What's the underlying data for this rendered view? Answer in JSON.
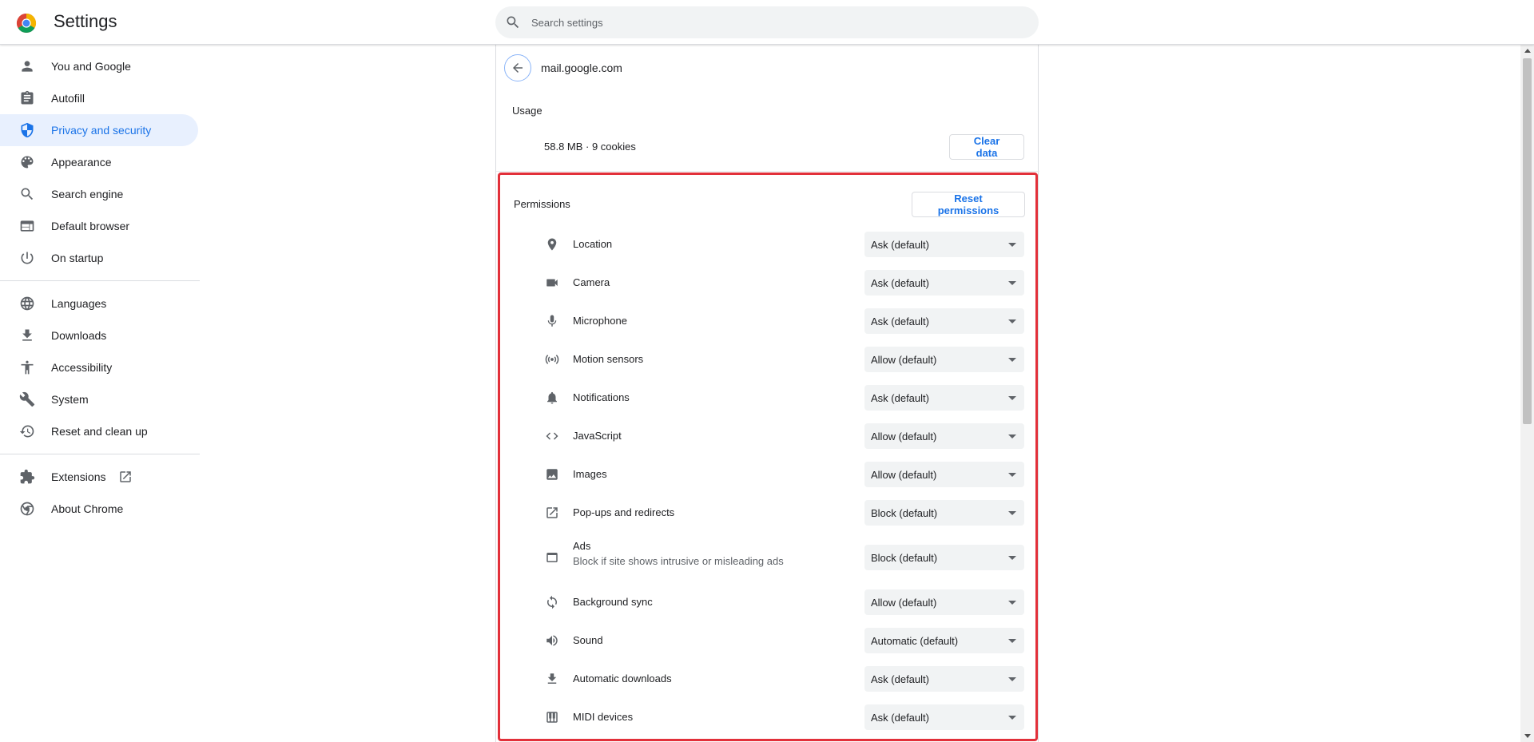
{
  "header": {
    "title": "Settings",
    "search_placeholder": "Search settings"
  },
  "sidebar": {
    "items": [
      {
        "label": "You and Google",
        "icon": "person-icon"
      },
      {
        "label": "Autofill",
        "icon": "clipboard-icon"
      },
      {
        "label": "Privacy and security",
        "icon": "shield-icon",
        "active": true
      },
      {
        "label": "Appearance",
        "icon": "palette-icon"
      },
      {
        "label": "Search engine",
        "icon": "search-icon"
      },
      {
        "label": "Default browser",
        "icon": "browser-icon"
      },
      {
        "label": "On startup",
        "icon": "power-icon"
      },
      {
        "label": "Languages",
        "icon": "globe-icon"
      },
      {
        "label": "Downloads",
        "icon": "download-icon"
      },
      {
        "label": "Accessibility",
        "icon": "accessibility-icon"
      },
      {
        "label": "System",
        "icon": "wrench-icon"
      },
      {
        "label": "Reset and clean up",
        "icon": "history-icon"
      },
      {
        "label": "Extensions",
        "icon": "puzzle-icon"
      },
      {
        "label": "About Chrome",
        "icon": "chrome-icon"
      }
    ]
  },
  "site": {
    "name": "mail.google.com",
    "usage_title": "Usage",
    "usage_value": "58.8 MB · 9 cookies",
    "clear_label": "Clear data"
  },
  "permissions": {
    "title": "Permissions",
    "reset_label": "Reset permissions",
    "rows": [
      {
        "name": "Location",
        "value": "Ask (default)",
        "icon": "location-icon"
      },
      {
        "name": "Camera",
        "value": "Ask (default)",
        "icon": "camera-icon"
      },
      {
        "name": "Microphone",
        "value": "Ask (default)",
        "icon": "microphone-icon"
      },
      {
        "name": "Motion sensors",
        "value": "Allow (default)",
        "icon": "sensors-icon"
      },
      {
        "name": "Notifications",
        "value": "Ask (default)",
        "icon": "bell-icon"
      },
      {
        "name": "JavaScript",
        "value": "Allow (default)",
        "icon": "code-icon"
      },
      {
        "name": "Images",
        "value": "Allow (default)",
        "icon": "image-icon"
      },
      {
        "name": "Pop-ups and redirects",
        "value": "Block (default)",
        "icon": "open-in-new-icon"
      },
      {
        "name": "Ads",
        "sub": "Block if site shows intrusive or misleading ads",
        "value": "Block (default)",
        "icon": "ads-window-icon"
      },
      {
        "name": "Background sync",
        "value": "Allow (default)",
        "icon": "sync-icon"
      },
      {
        "name": "Sound",
        "value": "Automatic (default)",
        "icon": "speaker-icon"
      },
      {
        "name": "Automatic downloads",
        "value": "Ask (default)",
        "icon": "download-icon"
      },
      {
        "name": "MIDI devices",
        "value": "Ask (default)",
        "icon": "piano-icon"
      }
    ]
  },
  "colors": {
    "accent": "#1a73e8",
    "active_bg": "#e8f0fe",
    "highlight_border": "#e2303a",
    "icon_gray": "#5f6368"
  }
}
